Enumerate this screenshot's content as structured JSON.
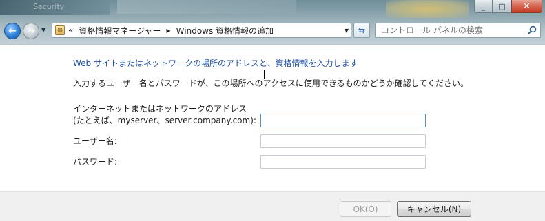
{
  "window": {
    "background_title": "Security",
    "buttons": {
      "minimize": "_",
      "maximize": "□",
      "close": "✕"
    }
  },
  "nav": {
    "address": {
      "overflow": "«",
      "crumb1": "資格情報マネージャー",
      "crumb2": "Windows 資格情報の追加"
    },
    "search_placeholder": "コントロール パネルの検索"
  },
  "form": {
    "heading": "Web サイトまたはネットワークの場所のアドレスと、資格情報を入力します",
    "instruction": "入力するユーザー名とパスワードが、この場所へのアクセスに使用できるものかどうか確認してください。",
    "address_label_line1": "インターネットまたはネットワークのアドレス",
    "address_label_line2": "(たとえば、myserver、server.company.com):",
    "address_value": "",
    "username_label": "ユーザー名:",
    "username_value": "",
    "password_label": "パスワード:",
    "password_value": ""
  },
  "footer": {
    "ok_label": "OK(O)",
    "cancel_label": "キャンセル(N)"
  },
  "colors": {
    "heading": "#1e4fa5",
    "accent": "#2f7fd8",
    "close_button": "#c53d25"
  }
}
